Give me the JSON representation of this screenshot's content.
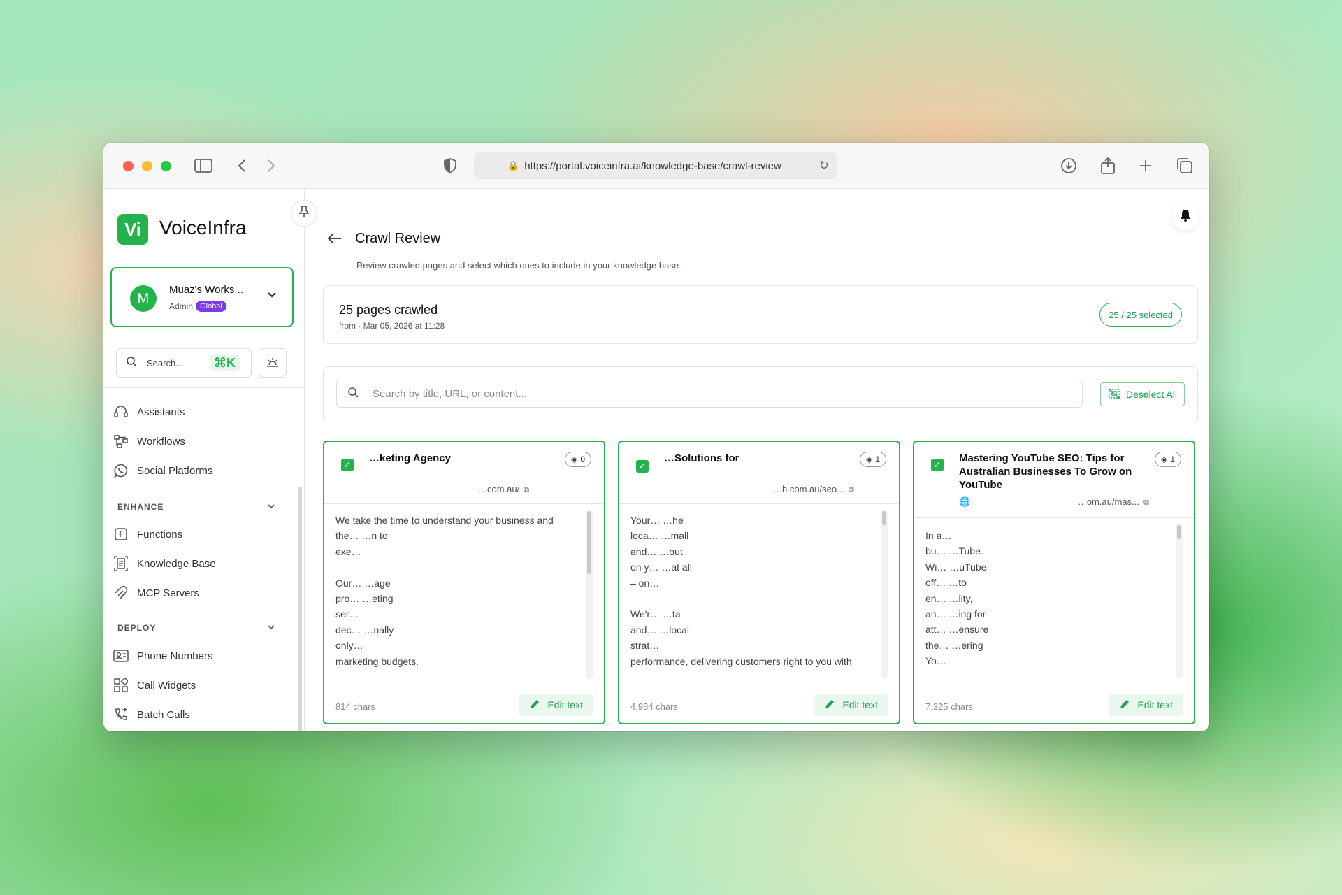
{
  "browser": {
    "url": "https://portal.voiceinfra.ai/knowledge-base/crawl-review"
  },
  "sidebar": {
    "brand": {
      "mark": "Vi",
      "name": "VoiceInfra"
    },
    "workspace": {
      "initial": "M",
      "name": "Muaz's Works...",
      "role": "Admin",
      "badge": "Global"
    },
    "search": {
      "placeholder": "Search...",
      "shortcut": "⌘K"
    },
    "items_main": [
      {
        "label": "Assistants",
        "icon": "headset-icon"
      },
      {
        "label": "Workflows",
        "icon": "workflow-icon"
      },
      {
        "label": "Social Platforms",
        "icon": "whatsapp-icon"
      }
    ],
    "enhance": {
      "title": "ENHANCE",
      "items": [
        {
          "label": "Functions",
          "icon": "function-icon"
        },
        {
          "label": "Knowledge Base",
          "icon": "document-icon"
        },
        {
          "label": "MCP Servers",
          "icon": "mcp-icon"
        }
      ]
    },
    "deploy": {
      "title": "DEPLOY",
      "items": [
        {
          "label": "Phone Numbers",
          "icon": "contact-card-icon"
        },
        {
          "label": "Call Widgets",
          "icon": "widgets-icon"
        },
        {
          "label": "Batch Calls",
          "icon": "phone-forward-icon"
        }
      ]
    }
  },
  "page": {
    "title": "Crawl Review",
    "subtitle": "Review crawled pages and select which ones to include in your knowledge base."
  },
  "summary": {
    "title": "25 pages crawled",
    "subtitle": "from · Mar 05, 2026 at 11:28",
    "selected": "25 / 25 selected"
  },
  "filter": {
    "placeholder": "Search by title, URL, or content...",
    "deselect_label": "Deselect All"
  },
  "cards": [
    {
      "title": "        …keting Agency",
      "chunks": "0",
      "url": "…com.au/",
      "text": "We take the time to understand your business and\nthe…                                 …n to\nexe…\n\nOur…                                 …age\npro…                                 …eting\nser…\ndec…                                 …nally\nonly…\nmarketing budgets.",
      "chars": "814 chars",
      "edit_label": "Edit text"
    },
    {
      "title": "        …Solutions for",
      "chunks": "1",
      "url": "…h.com.au/seo...",
      "text": "Your…                                 …he\nloca…                                 …mall\nand…                                 …out\non y…                                 …at all\n– on…\n\nWe'r…                                 …ta\nand…                                 …local\nstrat…\nperformance, delivering customers right to you with",
      "chars": "4,984 chars",
      "edit_label": "Edit text"
    },
    {
      "title": "Mastering YouTube SEO: Tips for Australian Businesses To Grow on YouTube",
      "chunks": "1",
      "url": "…om.au/mas...",
      "text": "In a…\nbu…                                 …Tube.\nWi…                                 …uTube\noff…                                 …to\nen…                                 …lity,\nan…                                 …ing for\natt…                                 …ensure\nthe…                                 …ering\nYo…",
      "chars": "7,325 chars",
      "edit_label": "Edit text"
    }
  ]
}
